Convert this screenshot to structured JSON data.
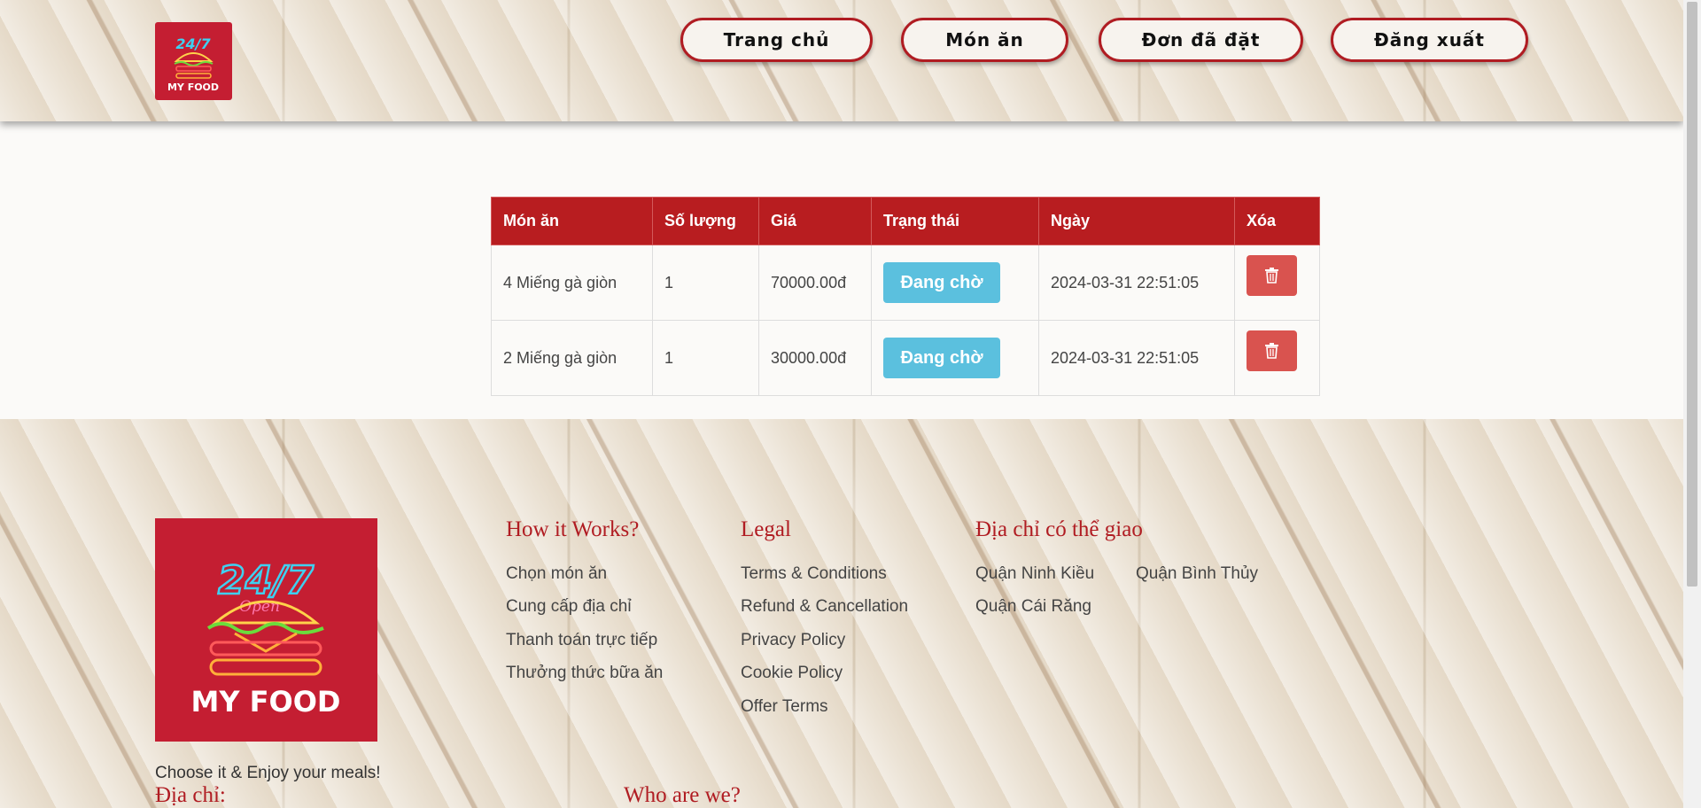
{
  "header": {
    "logo_label": "24/7 MY FOOD",
    "nav": [
      "Trang chủ",
      "Món ăn",
      "Đơn đã đặt",
      "Đăng xuất"
    ]
  },
  "orders": {
    "headers": [
      "Món ăn",
      "Số lượng",
      "Giá",
      "Trạng thái",
      "Ngày",
      "Xóa"
    ],
    "rows": [
      {
        "item": "4 Miếng gà giòn",
        "qty": "1",
        "price": "70000.00đ",
        "status": "Đang chờ",
        "date": "2024-03-31 22:51:05"
      },
      {
        "item": "2 Miếng gà giòn",
        "qty": "1",
        "price": "30000.00đ",
        "status": "Đang chờ",
        "date": "2024-03-31 22:51:05"
      }
    ],
    "delete_icon": "trash-icon",
    "status_color": "#5bc0de",
    "delete_color": "#d9534f",
    "header_color": "#b81d20"
  },
  "footer": {
    "tagline": "Choose it & Enjoy your meals!",
    "address_heading": "Địa chỉ:",
    "who_heading": "Who are we?",
    "how": {
      "heading": "How it Works?",
      "links": [
        "Chọn món ăn",
        "Cung cấp địa chỉ",
        "Thanh toán trực tiếp",
        "Thưởng thức bữa ăn"
      ]
    },
    "legal": {
      "heading": "Legal",
      "links": [
        "Terms & Conditions",
        "Refund & Cancellation",
        "Privacy Policy",
        "Cookie Policy",
        "Offer Terms"
      ]
    },
    "delivery": {
      "heading": "Địa chỉ có thể giao",
      "areas": [
        "Quận Ninh Kiều",
        "Quận Bình Thủy",
        "Quận Cái Răng"
      ]
    }
  }
}
